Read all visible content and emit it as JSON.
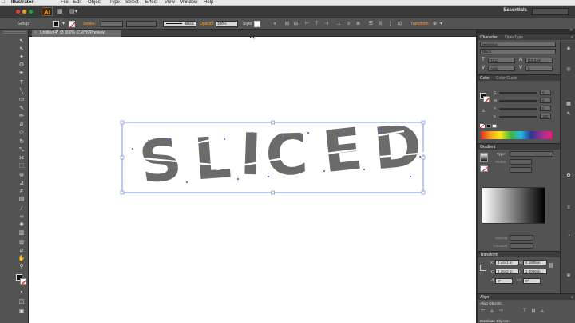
{
  "os_menu": {
    "app_name": "Illustrator",
    "items": [
      "File",
      "Edit",
      "Object",
      "Type",
      "Select",
      "Effect",
      "View",
      "Window",
      "Help"
    ]
  },
  "appbar": {
    "logo": "Ai",
    "workspace": "Essentials"
  },
  "control_bar": {
    "selection_type": "Group",
    "stroke_label": "Stroke:",
    "brush_value": "Basic",
    "opacity_label": "Opacity:",
    "opacity_value": "100%",
    "style_label": "Style:",
    "transform_label": "Transform"
  },
  "document": {
    "tab_title": "Untitled-4* @ 300% (CMYK/Preview)"
  },
  "artwork": {
    "text": "SLICED",
    "fill_color": "#6b6b6b",
    "selection_color": "#5a7bd8"
  },
  "character_panel": {
    "tab": "Character",
    "tab_secondary": "OpenType",
    "font_family": "Helvetica",
    "font_style": "Black",
    "size": "12 pt",
    "leading": "(14.4 pt)",
    "kerning": "Auto",
    "tracking": "0"
  },
  "color_panel": {
    "tab": "Color",
    "tab_secondary": "Color Guide",
    "channels": [
      {
        "label": "C",
        "value": "0"
      },
      {
        "label": "M",
        "value": "0"
      },
      {
        "label": "Y",
        "value": "0"
      },
      {
        "label": "K",
        "value": "100"
      }
    ]
  },
  "gradient_panel": {
    "tab": "Gradient",
    "type_label": "Type:",
    "stroke_label": "Stroke:",
    "opacity_label": "Opacity:",
    "location_label": "Location:"
  },
  "transform_panel": {
    "tab": "Transform",
    "x_label": "X:",
    "x_value": "4.4441 in",
    "y_label": "Y:",
    "y_value": "2.2642 in",
    "w_label": "W:",
    "w_value": "4.1805 in",
    "h_label": "H:",
    "h_value": "1.0066 in",
    "rotate_value": "0°",
    "shear_value": "0°"
  },
  "align_panel": {
    "tab": "Align",
    "align_objects_label": "Align Objects:",
    "distribute_label": "Distribute Objects:"
  }
}
